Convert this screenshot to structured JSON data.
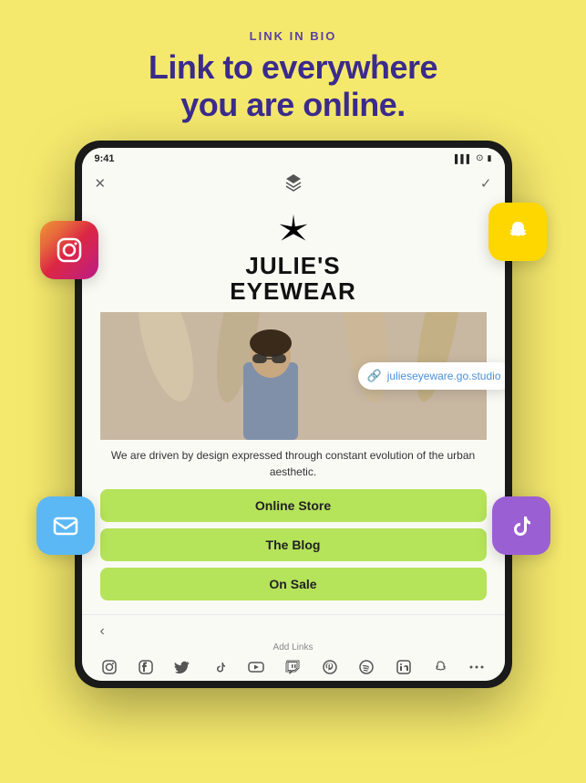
{
  "header": {
    "subtitle": "LINK IN BIO",
    "title_line1": "Link to everywhere",
    "title_line2": "you are online."
  },
  "tablet": {
    "status_bar": {
      "time": "9:41",
      "signal": "▌▌▌",
      "wifi": "WiFi",
      "battery": "🔋"
    },
    "brand": {
      "name_line1": "JULIE'S",
      "name_line2": "EYEWEAR"
    },
    "url_pill": {
      "icon": "🔗",
      "url": "julieseyeware.go.studio"
    },
    "description": "We are driven by design expressed through constant evolution of the urban aesthetic.",
    "buttons": [
      {
        "label": "Online Store"
      },
      {
        "label": "The Blog"
      },
      {
        "label": "On Sale"
      }
    ],
    "bottom_bar": {
      "add_links": "Add Links",
      "back": "‹"
    }
  },
  "social_icons": {
    "instagram": "📷",
    "snapchat": "👻",
    "mail": "✉",
    "tiktok": "♪"
  },
  "colors": {
    "background": "#F5E96D",
    "heading_color": "#3B2B8C",
    "subtitle_color": "#5B3FA8",
    "button_green": "#B5E35A",
    "brand_text": "#111111"
  }
}
